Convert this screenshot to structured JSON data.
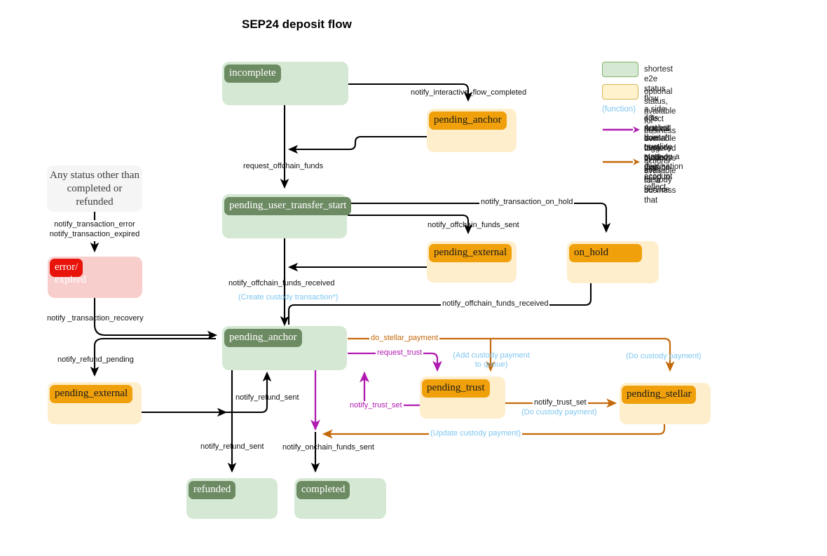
{
  "title": "SEP24 deposit flow",
  "colors": {
    "green_fill": "#d5e8d4",
    "green_label": "#6d8b63",
    "yellow_fill": "#ffeecc",
    "orange_label": "#efa00b",
    "pink_fill": "#f8cecc",
    "red_label": "#e8140c",
    "gray_fill": "#f5f5f5",
    "purple_edge": "#b01ab0",
    "orange_edge": "#c4690b",
    "blue_function": "#7ec6ef",
    "black_edge": "#000000",
    "legend_green_border": "#82b366",
    "legend_yellow_border": "#d6b656"
  },
  "legend": {
    "items": [
      {
        "kind": "swatch-green",
        "text": "shortest e2e status flow"
      },
      {
        "kind": "swatch-yellow",
        "text": "optional status, available for business"
      },
      {
        "kind": "function",
        "marker": "(function)",
        "text": "a side effect that will be triggered by an action\nif its Anchor is in custody mode"
      },
      {
        "kind": "arrow-purple",
        "text": "actions available for a business that\ndoesn't use custody. Can be used to reflect\ntrustline state on a destination account"
      },
      {
        "kind": "arrow-orange",
        "text": "actions available for a business that\nuses custody service"
      }
    ],
    "l0": "shortest e2e status flow",
    "l1": "optional status, available for business",
    "l2_marker": "(function)",
    "l2a": "a side effect that will be triggered by an action",
    "l2b": "if its Anchor is in custody mode",
    "l3a": "actions available for a business that",
    "l3b": "doesn't use custody. Can be used to reflect",
    "l3c": "trustline state on a destination account",
    "l4a": "actions available for a business that",
    "l4b": "uses custody service"
  },
  "nodes": {
    "incomplete": {
      "label": "incomplete",
      "style": "green"
    },
    "pending_anchor_top": {
      "label": "pending_anchor",
      "style": "yellow"
    },
    "any_status": {
      "line1": "Any status other than",
      "line2": "completed or",
      "line3": "refunded",
      "style": "gray"
    },
    "error_expired": {
      "label_line1": "error/",
      "label_line2": "expired",
      "style": "pink"
    },
    "pending_user_transfer_start": {
      "label": "pending_user_transfer_start",
      "style": "green"
    },
    "pending_external_top": {
      "label": "pending_external",
      "style": "yellow"
    },
    "on_hold": {
      "label": "on_hold",
      "style": "yellow"
    },
    "pending_anchor_mid": {
      "label": "pending_anchor",
      "style": "green"
    },
    "pending_external_left": {
      "label": "pending_external",
      "style": "yellow"
    },
    "pending_trust": {
      "label": "pending_trust",
      "style": "yellow"
    },
    "pending_stellar": {
      "label": "pending_stellar",
      "style": "yellow"
    },
    "refunded": {
      "label": "refunded",
      "style": "green"
    },
    "completed": {
      "label": "completed",
      "style": "green"
    }
  },
  "edges": {
    "notify_interactive_flow_completed": "notify_interactive_flow_completed",
    "request_offchain_funds": "request_offchain_funds",
    "notify_transaction_error": "notify_transaction_error",
    "notify_transaction_expired": "notify_transaction_expired",
    "notify_transaction_recovery": "notify _transaction_recovery",
    "notify_transaction_on_hold": "notify_transaction_on_hold",
    "notify_offchain_funds_sent": "notify_offchain_funds_sent",
    "notify_offchain_funds_received_left": "notify_offchain_funds_received",
    "create_custody_transaction": "(Create custody transaction*)",
    "notify_offchain_funds_received_right": "notify_offchain_funds_received",
    "notify_refund_pending": "notify_refund_pending",
    "do_stellar_payment": "do_stellar_payment",
    "request_trust": "request_trust",
    "add_custody_payment_to_queue_1": "(Add custody payment",
    "add_custody_payment_to_queue_2": "to queue)",
    "do_custody_payment_top": "(Do custody payment)",
    "notify_trust_set_left": "notify_trust_set",
    "notify_trust_set_right": "notify_trust_set",
    "do_custody_payment_mid": "(Do custody payment)",
    "update_custody_payment": "(Update custody payment)",
    "notify_refund_sent_up": "notify_refund_sent",
    "notify_refund_sent_down": "notify_refund_sent",
    "notify_onchain_funds_sent": "notify_onchain_funds_sent"
  }
}
